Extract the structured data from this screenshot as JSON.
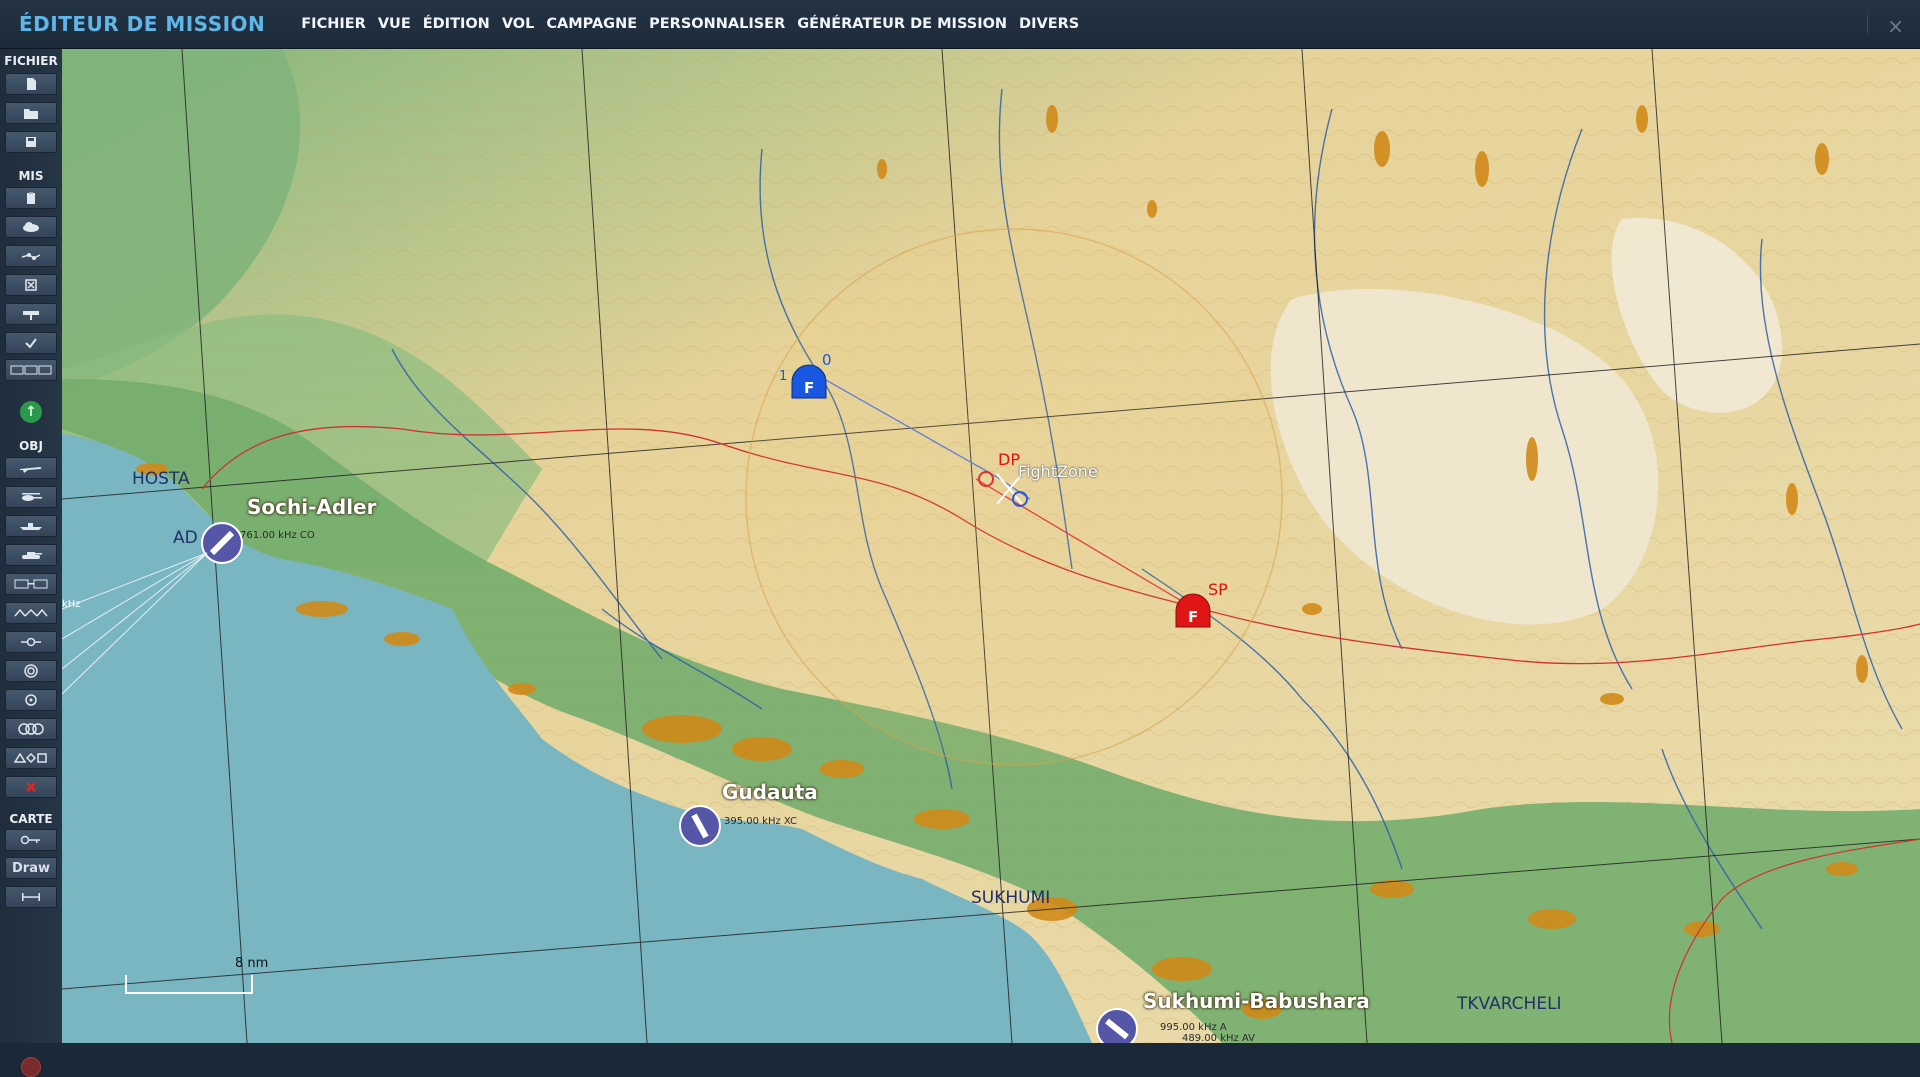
{
  "app": {
    "title": "ÉDITEUR DE MISSION",
    "close": "×"
  },
  "menu": [
    "FICHIER",
    "VUE",
    "ÉDITION",
    "VOL",
    "CAMPAGNE",
    "PERSONNALISER",
    "GÉNÉRATEUR DE MISSION",
    "DIVERS"
  ],
  "toolbar": {
    "sections": {
      "file": "FICHIER",
      "mis": "MIS",
      "obj": "OBJ",
      "map": "CARTE"
    },
    "draw_label": "Draw"
  },
  "map": {
    "airfields": [
      {
        "name": "Sochi-Adler",
        "freq": "761.00 kHz CO"
      },
      {
        "name": "Gudauta",
        "freq": "395.00 kHz XC"
      },
      {
        "name": "Sukhumi-Babushara",
        "freq": "995.00 kHz A",
        "freq2": "489.00 kHz AV"
      }
    ],
    "places": [
      "HOSTA",
      "SUKHUMI",
      "TKVARCHELI"
    ],
    "place_fragments": {
      "adler_cut": "AD",
      "khz_cut": "kHz"
    },
    "units": {
      "blue": {
        "label": "F",
        "number": "0",
        "index": "1",
        "color": "#1a57e0"
      },
      "red": {
        "label": "F",
        "waypoint": "SP",
        "color": "#e01515"
      }
    },
    "waypoint_dp": "DP",
    "zone": {
      "name": "FightZone"
    },
    "scale": {
      "label": "8 nm"
    },
    "colors": {
      "sea": "#79b6c2",
      "lowland": "#6da86a",
      "highland": "#e7d39a",
      "forest": "#d08a18",
      "river": "#2b5fa8",
      "route": "#d03030"
    }
  }
}
